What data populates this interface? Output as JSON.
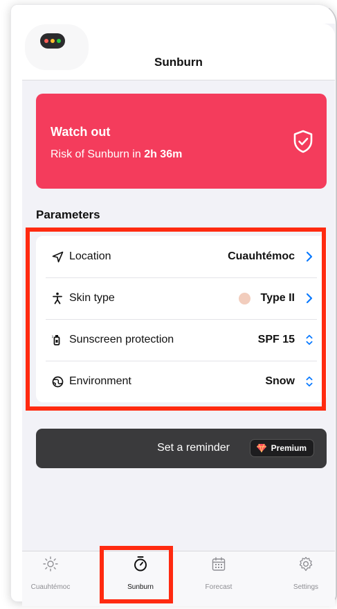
{
  "header": {
    "title": "Sunburn"
  },
  "warning": {
    "title": "Watch out",
    "subtitle_prefix": "Risk of Sunburn in ",
    "subtitle_time": "2h 36m",
    "icon": "shield-check-icon",
    "color": "#f43c5c"
  },
  "parameters": {
    "title": "Parameters",
    "rows": [
      {
        "icon": "location-arrow-icon",
        "label": "Location",
        "value": "Cuauhtémoc",
        "control": "chevron-right-icon"
      },
      {
        "icon": "person-icon",
        "label": "Skin type",
        "value": "Type II",
        "swatch": "#f2cdbd",
        "control": "chevron-right-icon"
      },
      {
        "icon": "sunscreen-bottle-icon",
        "label": "Sunscreen protection",
        "value": "SPF 15",
        "control": "chevron-updown-icon"
      },
      {
        "icon": "globe-icon",
        "label": "Environment",
        "value": "Snow",
        "control": "chevron-updown-icon"
      }
    ]
  },
  "reminder": {
    "label": "Set a reminder",
    "badge": "Premium",
    "badge_icon": "diamond-icon"
  },
  "tabs": [
    {
      "label": "Cuauhtémoc",
      "icon": "sun-icon"
    },
    {
      "label": "Sunburn",
      "icon": "timer-icon",
      "active": true
    },
    {
      "label": "Forecast",
      "icon": "calendar-icon"
    },
    {
      "label": "Settings",
      "icon": "gear-icon"
    }
  ],
  "colors": {
    "accent": "#0a7aff",
    "highlight": "#ff2a10"
  }
}
